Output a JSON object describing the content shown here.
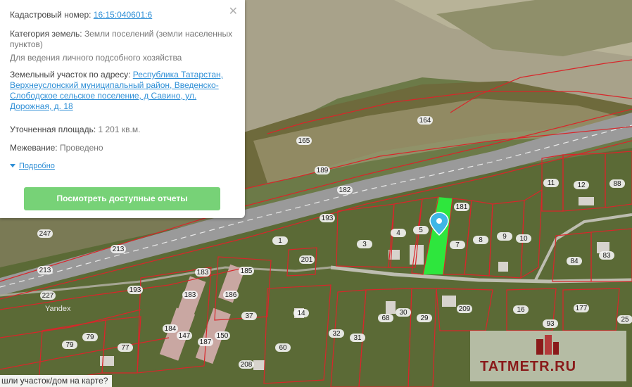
{
  "info_panel": {
    "cadastral_label": "Кадастровый номер:",
    "cadastral_number": "16:15:040601:6",
    "category_label": "Категория земель:",
    "category_value": "Земли поселений (земли населенных пунктов)",
    "usage": "Для ведения личного подсобного хозяйства",
    "address_label": "Земельный участок по адресу:",
    "address_value": "Республика Татарстан, Верхнеуслонский муниципальный район, Введенско-Слободское сельское поселение, д Савино, ул. Дорожная, д. 18",
    "area_label": "Уточненная площадь:",
    "area_value": "1 201 кв.м.",
    "survey_label": "Межевание:",
    "survey_value": "Проведено",
    "more_link": "Подробно",
    "reports_button": "Посмотреть доступные отчеты",
    "close_icon": "close-icon"
  },
  "map": {
    "labels": [
      "164",
      "165",
      "189",
      "182",
      "193",
      "247",
      "213",
      "213",
      "227",
      "193",
      "183",
      "183",
      "185",
      "186",
      "37",
      "201",
      "1",
      "3",
      "4",
      "5",
      "181",
      "7",
      "8",
      "9",
      "10",
      "11",
      "12",
      "88",
      "84",
      "83",
      "177",
      "93",
      "25",
      "16",
      "209",
      "29",
      "30",
      "68",
      "31",
      "32",
      "60",
      "150",
      "187",
      "147",
      "184",
      "79",
      "79",
      "77",
      "208",
      "14"
    ],
    "selected_plot_color": "#2ee63d",
    "boundary_color": "#d8262a",
    "pin_color": "#3fb6e6",
    "attribution": "Yandex",
    "watermark": "TATMETR.RU",
    "footer_question": "шли участок/дом на карте?"
  }
}
